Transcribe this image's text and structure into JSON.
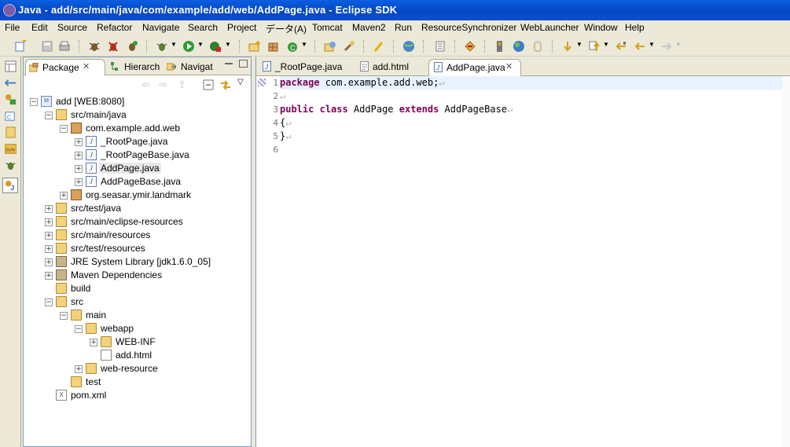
{
  "window": {
    "title": "Java - add/src/main/java/com/example/add/web/AddPage.java - Eclipse SDK"
  },
  "menu": [
    "File",
    "Edit",
    "Source",
    "Refactor",
    "Navigate",
    "Search",
    "Project",
    "データ(A)",
    "Tomcat",
    "Maven2",
    "Run",
    "ResourceSynchronizer",
    "WebLauncher",
    "Window",
    "Help"
  ],
  "package_explorer": {
    "tabs": [
      {
        "label": "Package",
        "icon": "package-explorer-icon",
        "close": "✕",
        "active": true
      },
      {
        "label": "Hierarch",
        "icon": "hierarchy-icon",
        "active": false
      },
      {
        "label": "Navigat",
        "icon": "navigator-icon",
        "active": false
      }
    ],
    "tree": [
      {
        "label": "add [WEB:8080]",
        "icon": "project-icon",
        "icon_text": "M",
        "level": 0,
        "toggle": "−"
      },
      {
        "label": "src/main/java",
        "icon": "source-folder-icon",
        "level": 1,
        "toggle": "−"
      },
      {
        "label": "com.example.add.web",
        "icon": "package-icon",
        "level": 2,
        "toggle": "−"
      },
      {
        "label": "_RootPage.java",
        "icon": "java-file-icon",
        "icon_text": "J",
        "level": 3,
        "toggle": "+"
      },
      {
        "label": "_RootPageBase.java",
        "icon": "java-file-icon",
        "icon_text": "J",
        "level": 3,
        "toggle": "+"
      },
      {
        "label": "AddPage.java",
        "icon": "java-file-icon",
        "icon_text": "J",
        "level": 3,
        "toggle": "+",
        "selected": true
      },
      {
        "label": "AddPageBase.java",
        "icon": "java-file-icon",
        "icon_text": "J",
        "level": 3,
        "toggle": "+"
      },
      {
        "label": "org.seasar.ymir.landmark",
        "icon": "package-icon",
        "level": 2,
        "toggle": "+"
      },
      {
        "label": "src/test/java",
        "icon": "source-folder-icon",
        "level": 1,
        "toggle": "+"
      },
      {
        "label": "src/main/eclipse-resources",
        "icon": "source-folder-icon",
        "level": 1,
        "toggle": "+"
      },
      {
        "label": "src/main/resources",
        "icon": "source-folder-icon",
        "level": 1,
        "toggle": "+"
      },
      {
        "label": "src/test/resources",
        "icon": "source-folder-icon",
        "level": 1,
        "toggle": "+"
      },
      {
        "label": "JRE System Library [jdk1.6.0_05]",
        "icon": "library-icon",
        "level": 1,
        "toggle": "+"
      },
      {
        "label": "Maven Dependencies",
        "icon": "library-icon",
        "level": 1,
        "toggle": "+"
      },
      {
        "label": "build",
        "icon": "folder-icon",
        "level": 1,
        "toggle": ""
      },
      {
        "label": "src",
        "icon": "folder-icon",
        "level": 1,
        "toggle": "−"
      },
      {
        "label": "main",
        "icon": "folder-icon",
        "level": 2,
        "toggle": "−"
      },
      {
        "label": "webapp",
        "icon": "folder-icon",
        "level": 3,
        "toggle": "−"
      },
      {
        "label": "WEB-INF",
        "icon": "folder-icon",
        "level": 4,
        "toggle": "+"
      },
      {
        "label": "add.html",
        "icon": "html-file-icon",
        "level": 4,
        "toggle": ""
      },
      {
        "label": "web-resource",
        "icon": "folder-icon",
        "level": 3,
        "toggle": "+"
      },
      {
        "label": "test",
        "icon": "folder-icon",
        "level": 2,
        "toggle": ""
      },
      {
        "label": "pom.xml",
        "icon": "xml-file-icon",
        "icon_text": "X",
        "level": 1,
        "toggle": ""
      }
    ]
  },
  "editor": {
    "tabs": [
      {
        "label": "_RootPage.java",
        "icon": "java-file-icon",
        "active": false
      },
      {
        "label": "add.html",
        "icon": "html-file-icon",
        "active": false
      },
      {
        "label": "AddPage.java",
        "icon": "java-file-icon",
        "active": true,
        "close": "✕"
      }
    ],
    "lines": [
      {
        "n": "1",
        "parts": [
          [
            "kw",
            "package"
          ],
          [
            "t",
            " com.example.add.web;"
          ],
          [
            "eol",
            "↵"
          ]
        ]
      },
      {
        "n": "2",
        "parts": [
          [
            "eol",
            "↵"
          ]
        ]
      },
      {
        "n": "3",
        "parts": [
          [
            "kw",
            "public"
          ],
          [
            "t",
            " "
          ],
          [
            "kw",
            "class"
          ],
          [
            "t",
            " AddPage "
          ],
          [
            "kw",
            "extends"
          ],
          [
            "t",
            " AddPageBase"
          ],
          [
            "eol",
            "↵"
          ]
        ]
      },
      {
        "n": "4",
        "parts": [
          [
            "t",
            "{"
          ],
          [
            "eol",
            "↵"
          ]
        ]
      },
      {
        "n": "5",
        "parts": [
          [
            "t",
            "}"
          ],
          [
            "eol",
            "↵"
          ]
        ]
      },
      {
        "n": "6",
        "parts": []
      }
    ]
  }
}
